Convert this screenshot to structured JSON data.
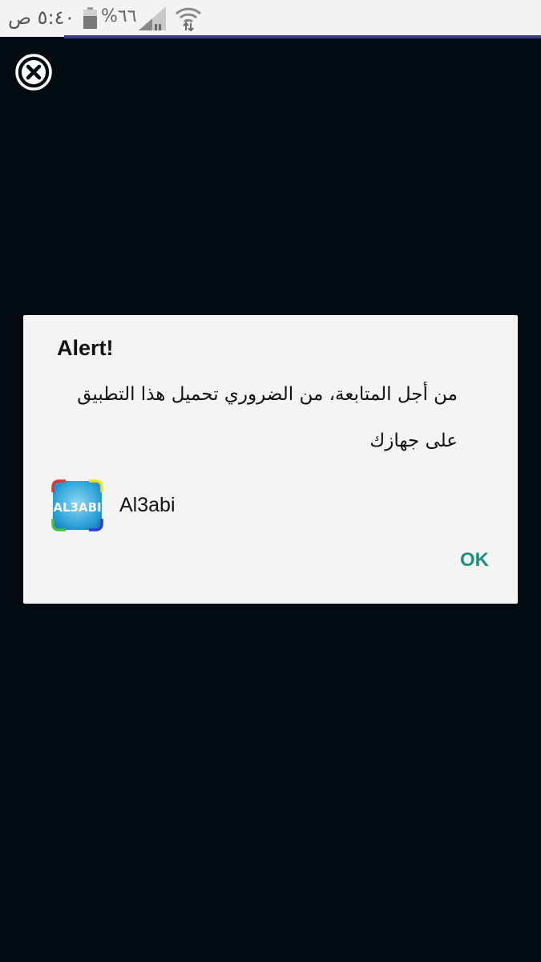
{
  "status_bar": {
    "time": "٥:٤٠ ص",
    "battery": "%٦٦",
    "icons": [
      "battery-icon",
      "signal-icon",
      "wifi-icon"
    ]
  },
  "close_icon": "close-icon",
  "dialog": {
    "title": "Alert!",
    "message": "من أجل المتابعة، من الضروري تحميل هذا التطبيق على جهازك",
    "app": {
      "name": "Al3abi",
      "icon_text": "AL3ABI",
      "icon": "app-icon"
    },
    "ok_label": "OK"
  },
  "colors": {
    "background": "#030a12",
    "dialog": "#f4f4f4",
    "accent": "#1c8f80",
    "status_line": "#3d3a8a"
  }
}
